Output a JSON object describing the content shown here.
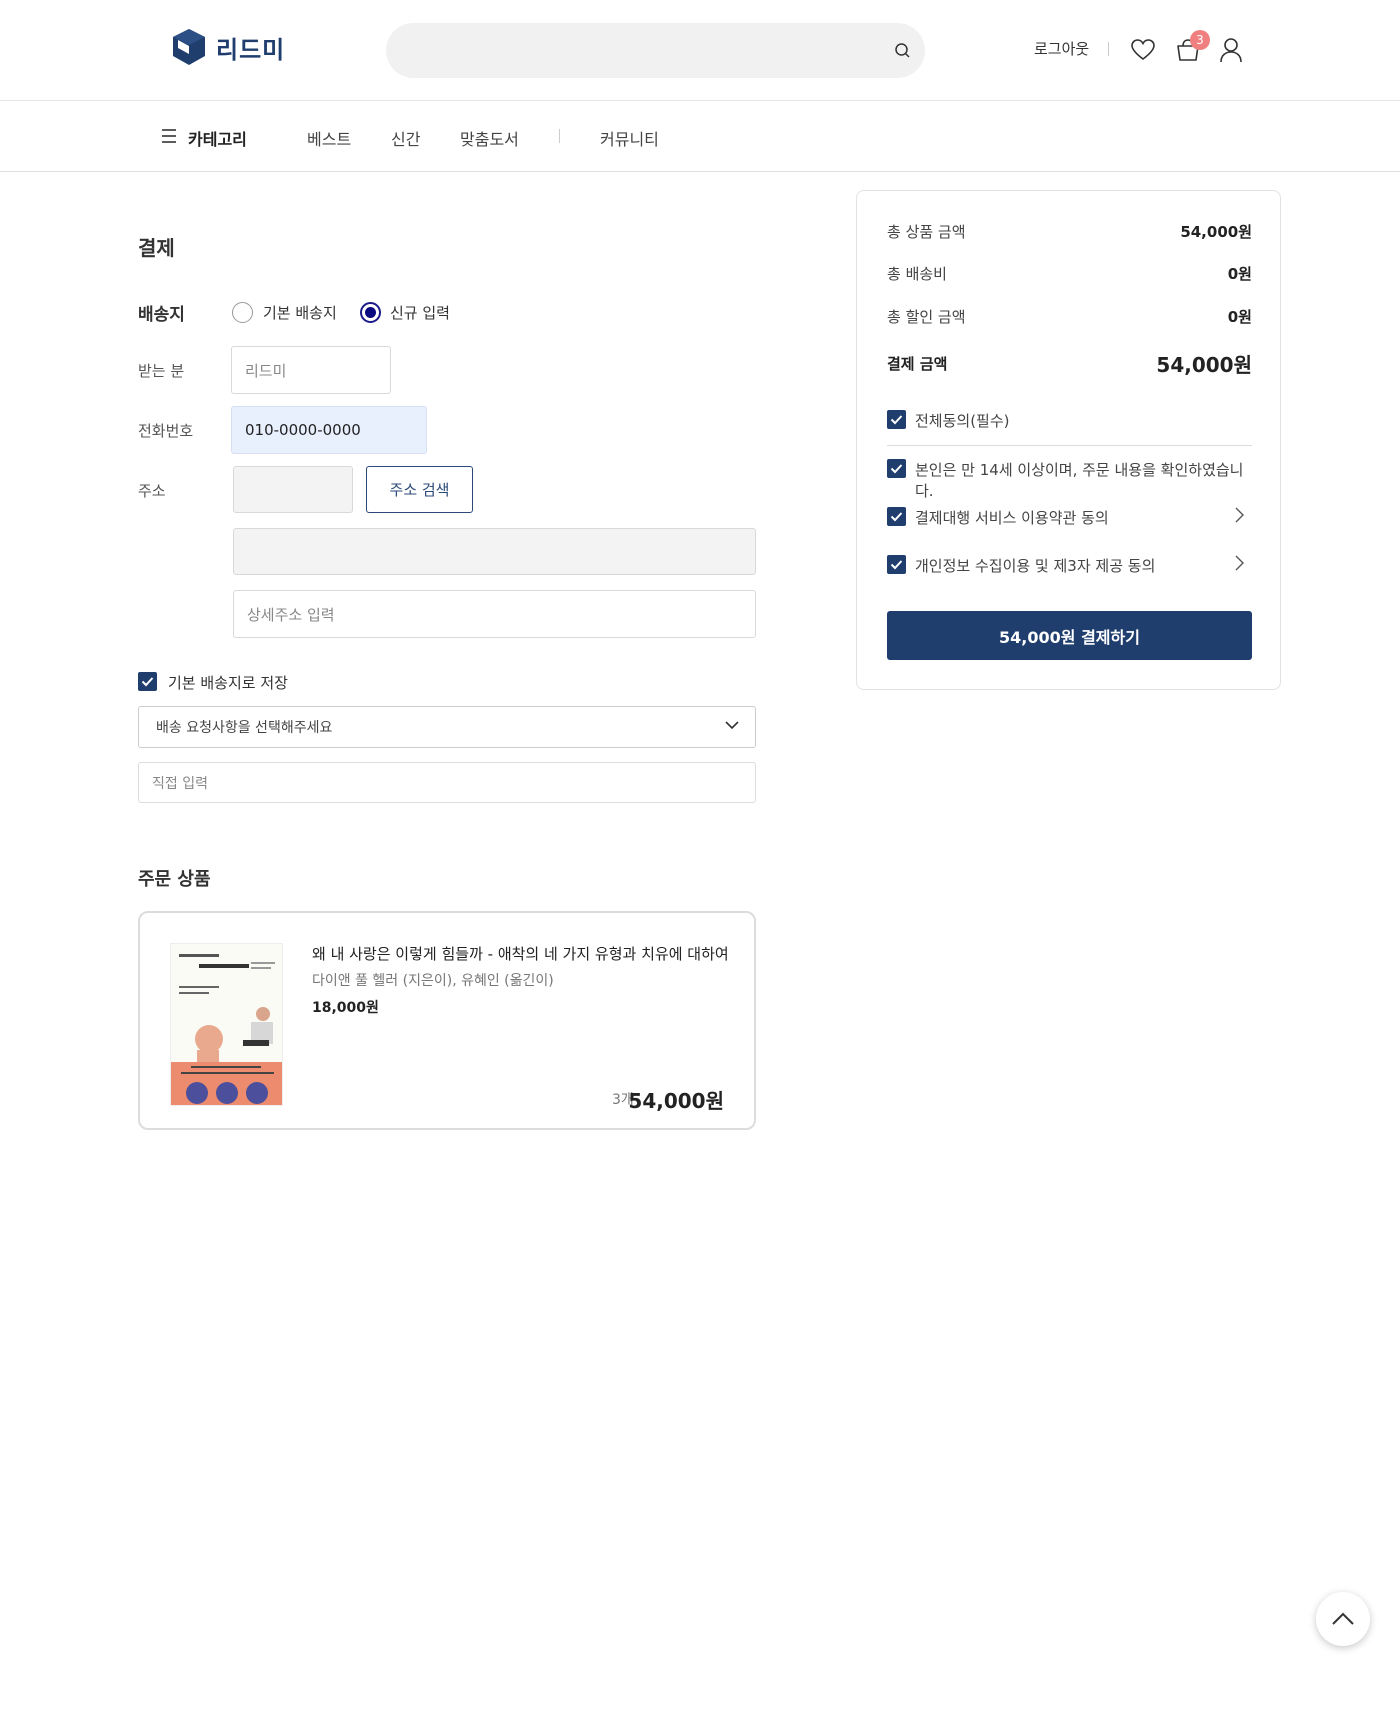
{
  "header": {
    "logo_text": "리드미",
    "search_value": "",
    "logout_label": "로그아웃",
    "cart_count": "3"
  },
  "nav": {
    "category_label": "카테고리",
    "items": [
      "베스트",
      "신간",
      "맞춤도서",
      "커뮤니티"
    ]
  },
  "form": {
    "title": "결제",
    "shipping_label": "배송지",
    "radio_default": "기본 배송지",
    "radio_new": "신규 입력",
    "recipient_label": "받는 분",
    "recipient_placeholder": "리드미",
    "phone_label": "전화번호",
    "phone_value": "010-0000-0000",
    "address_label": "주소",
    "address_search_button": "주소 검색",
    "detail_address_placeholder": "상세주소 입력",
    "save_default_label": "기본 배송지로 저장",
    "request_select": "배송 요청사항을 선택해주세요",
    "direct_input_placeholder": "직접 입력"
  },
  "order": {
    "title": "주문 상품",
    "book_title": "왜 내 사랑은 이렇게 힘들까 - 애착의 네 가지 유형과 치유에 대하여",
    "book_author": "다이앤 풀 헬러 (지은이), 유혜인 (옮긴이)",
    "unit_price": "18,000원",
    "quantity": "3개",
    "total_price": "54,000원"
  },
  "summary": {
    "rows": [
      {
        "label": "총 상품 금액",
        "value": "54,000원"
      },
      {
        "label": "총 배송비",
        "value": "0원"
      },
      {
        "label": "총 할인 금액",
        "value": "0원"
      }
    ],
    "final_label": "결제 금액",
    "final_value": "54,000원",
    "agree_all": "전체동의(필수)",
    "agree_items": [
      "본인은 만 14세 이상이며, 주문 내용을 확인하였습니다.",
      "결제대행 서비스 이용약관 동의",
      "개인정보 수집이용 및 제3자 제공 동의"
    ],
    "pay_button": "54,000원 결제하기"
  },
  "colors": {
    "brand": "#1f3e6d",
    "badge": "#f08080",
    "autofill": "#e8f0fe"
  }
}
